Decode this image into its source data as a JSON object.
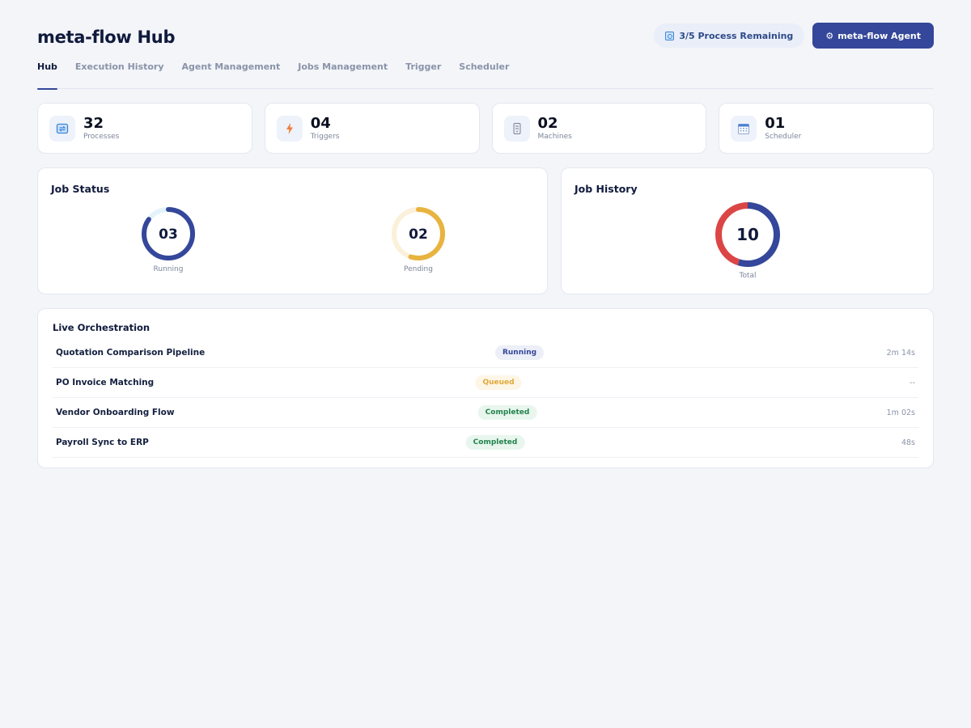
{
  "header": {
    "title": "meta-flow Hub",
    "quota_label": "3/5 Process Remaining",
    "agent_button_label": "meta-flow Agent"
  },
  "tabs": [
    {
      "label": "Hub",
      "active": true
    },
    {
      "label": "Execution History",
      "active": false
    },
    {
      "label": "Agent Management",
      "active": false
    },
    {
      "label": "Jobs Management",
      "active": false
    },
    {
      "label": "Trigger",
      "active": false
    },
    {
      "label": "Scheduler",
      "active": false
    }
  ],
  "stats": [
    {
      "value": "32",
      "label": "Processes",
      "icon": "processes-icon"
    },
    {
      "value": "04",
      "label": "Triggers",
      "icon": "lightning-icon"
    },
    {
      "value": "02",
      "label": "Machines",
      "icon": "server-icon"
    },
    {
      "value": "01",
      "label": "Scheduler",
      "icon": "calendar-icon"
    }
  ],
  "job_status": {
    "title": "Job Status",
    "running": {
      "value": "03",
      "label": "Running",
      "fraction": 0.85,
      "color": "#34479a",
      "track": "#e3f3fb"
    },
    "pending": {
      "value": "02",
      "label": "Pending",
      "fraction": 0.55,
      "color": "#e8b33f",
      "track": "#fbf0d9"
    }
  },
  "job_history": {
    "title": "Job History",
    "total": {
      "value": "10",
      "label": "Total"
    },
    "segments": [
      {
        "fraction": 0.55,
        "color": "#34479a"
      },
      {
        "fraction": 0.45,
        "color": "#dc4545"
      }
    ]
  },
  "live": {
    "title": "Live Orchestration",
    "rows": [
      {
        "name": "Quotation Comparison Pipeline",
        "status": "Running",
        "status_class": "badge-running",
        "time": "2m 14s"
      },
      {
        "name": "PO Invoice Matching",
        "status": "Queued",
        "status_class": "badge-queued",
        "time": "--"
      },
      {
        "name": "Vendor Onboarding Flow",
        "status": "Completed",
        "status_class": "badge-completed",
        "time": "1m 02s"
      },
      {
        "name": "Payroll Sync to ERP",
        "status": "Completed",
        "status_class": "badge-completed",
        "time": "48s"
      }
    ]
  }
}
